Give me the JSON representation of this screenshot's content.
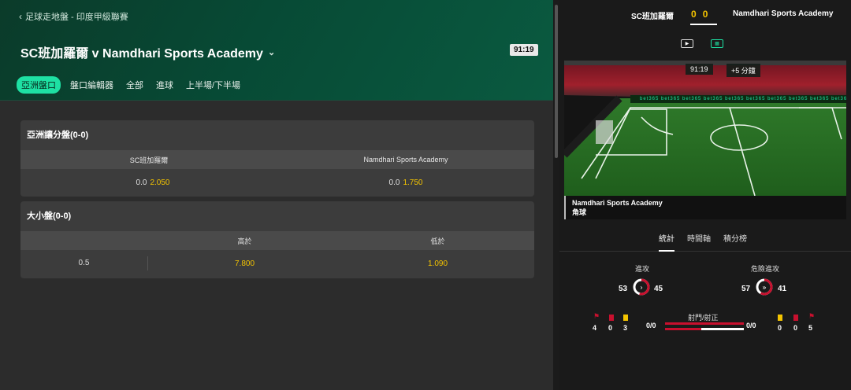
{
  "breadcrumb": {
    "text": "足球走地盤 - 印度甲級聯賽"
  },
  "match": {
    "title": "SC班加羅爾 v Namdhari Sports Academy",
    "clock": "91:19"
  },
  "tabs": [
    "亞洲盤口",
    "盤口編輯器",
    "全部",
    "進球",
    "上半場/下半場"
  ],
  "markets": {
    "handicap": {
      "title": "亞洲讓分盤(0-0)",
      "home_name": "SC班加羅爾",
      "away_name": "Namdhari Sports Academy",
      "home_line": "0.0",
      "home_odd": "2.050",
      "away_line": "0.0",
      "away_odd": "1.750"
    },
    "totals": {
      "title": "大小盤(0-0)",
      "over_label": "高於",
      "under_label": "低於",
      "line": "0.5",
      "over_odd": "7.800",
      "under_odd": "1.090"
    }
  },
  "scoreboard": {
    "home": "SC班加羅爾",
    "away": "Namdhari Sports Academy",
    "home_score": "0",
    "away_score": "0"
  },
  "pitch": {
    "clock": "91:19",
    "added": "+5 分鐘",
    "event_team": "Namdhari Sports Academy",
    "event_type": "角球",
    "board_text": "bet365"
  },
  "stat_tabs": [
    "統計",
    "時間軸",
    "積分榜"
  ],
  "stats": {
    "attacks": {
      "label": "進攻",
      "home": "53",
      "away": "45"
    },
    "danger": {
      "label": "危險進攻",
      "home": "57",
      "away": "41"
    },
    "shots": {
      "label": "射門/射正",
      "home": "0/0",
      "away": "0/0"
    },
    "home_counts": {
      "corners": "4",
      "red": "0",
      "yellow": "3"
    },
    "away_counts": {
      "yellow": "0",
      "red": "0",
      "corners": "5"
    }
  },
  "colors": {
    "accent": "#1ee0a3",
    "odds": "#f4c400",
    "home": "#c8102e"
  }
}
